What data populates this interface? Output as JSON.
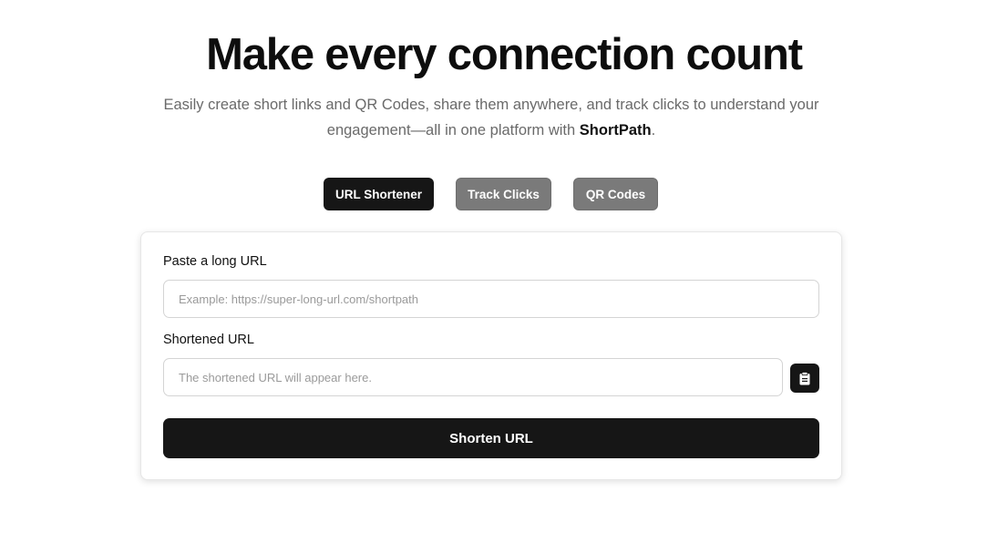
{
  "hero": {
    "title": "Make every connection count",
    "subtitle_line1": "Easily create short links and QR Codes, share them anywhere, and track clicks to understand your",
    "subtitle_line2_prefix": "engagement—all in one platform with ",
    "brand": "ShortPath",
    "subtitle_line2_suffix": "."
  },
  "tabs": [
    {
      "label": "URL Shortener",
      "active": true
    },
    {
      "label": "Track Clicks",
      "active": false
    },
    {
      "label": "QR Codes",
      "active": false
    }
  ],
  "form": {
    "long_url_label": "Paste a long URL",
    "long_url_placeholder": "Example: https://super-long-url.com/shortpath",
    "long_url_value": "",
    "short_url_label": "Shortened URL",
    "short_url_placeholder": "The shortened URL will appear here.",
    "short_url_value": "",
    "copy_icon": "clipboard-icon",
    "submit_label": "Shorten URL"
  },
  "colors": {
    "primary_dark": "#161616",
    "tab_inactive": "#7a7a7a",
    "subtitle_text": "#6a6a6a"
  }
}
